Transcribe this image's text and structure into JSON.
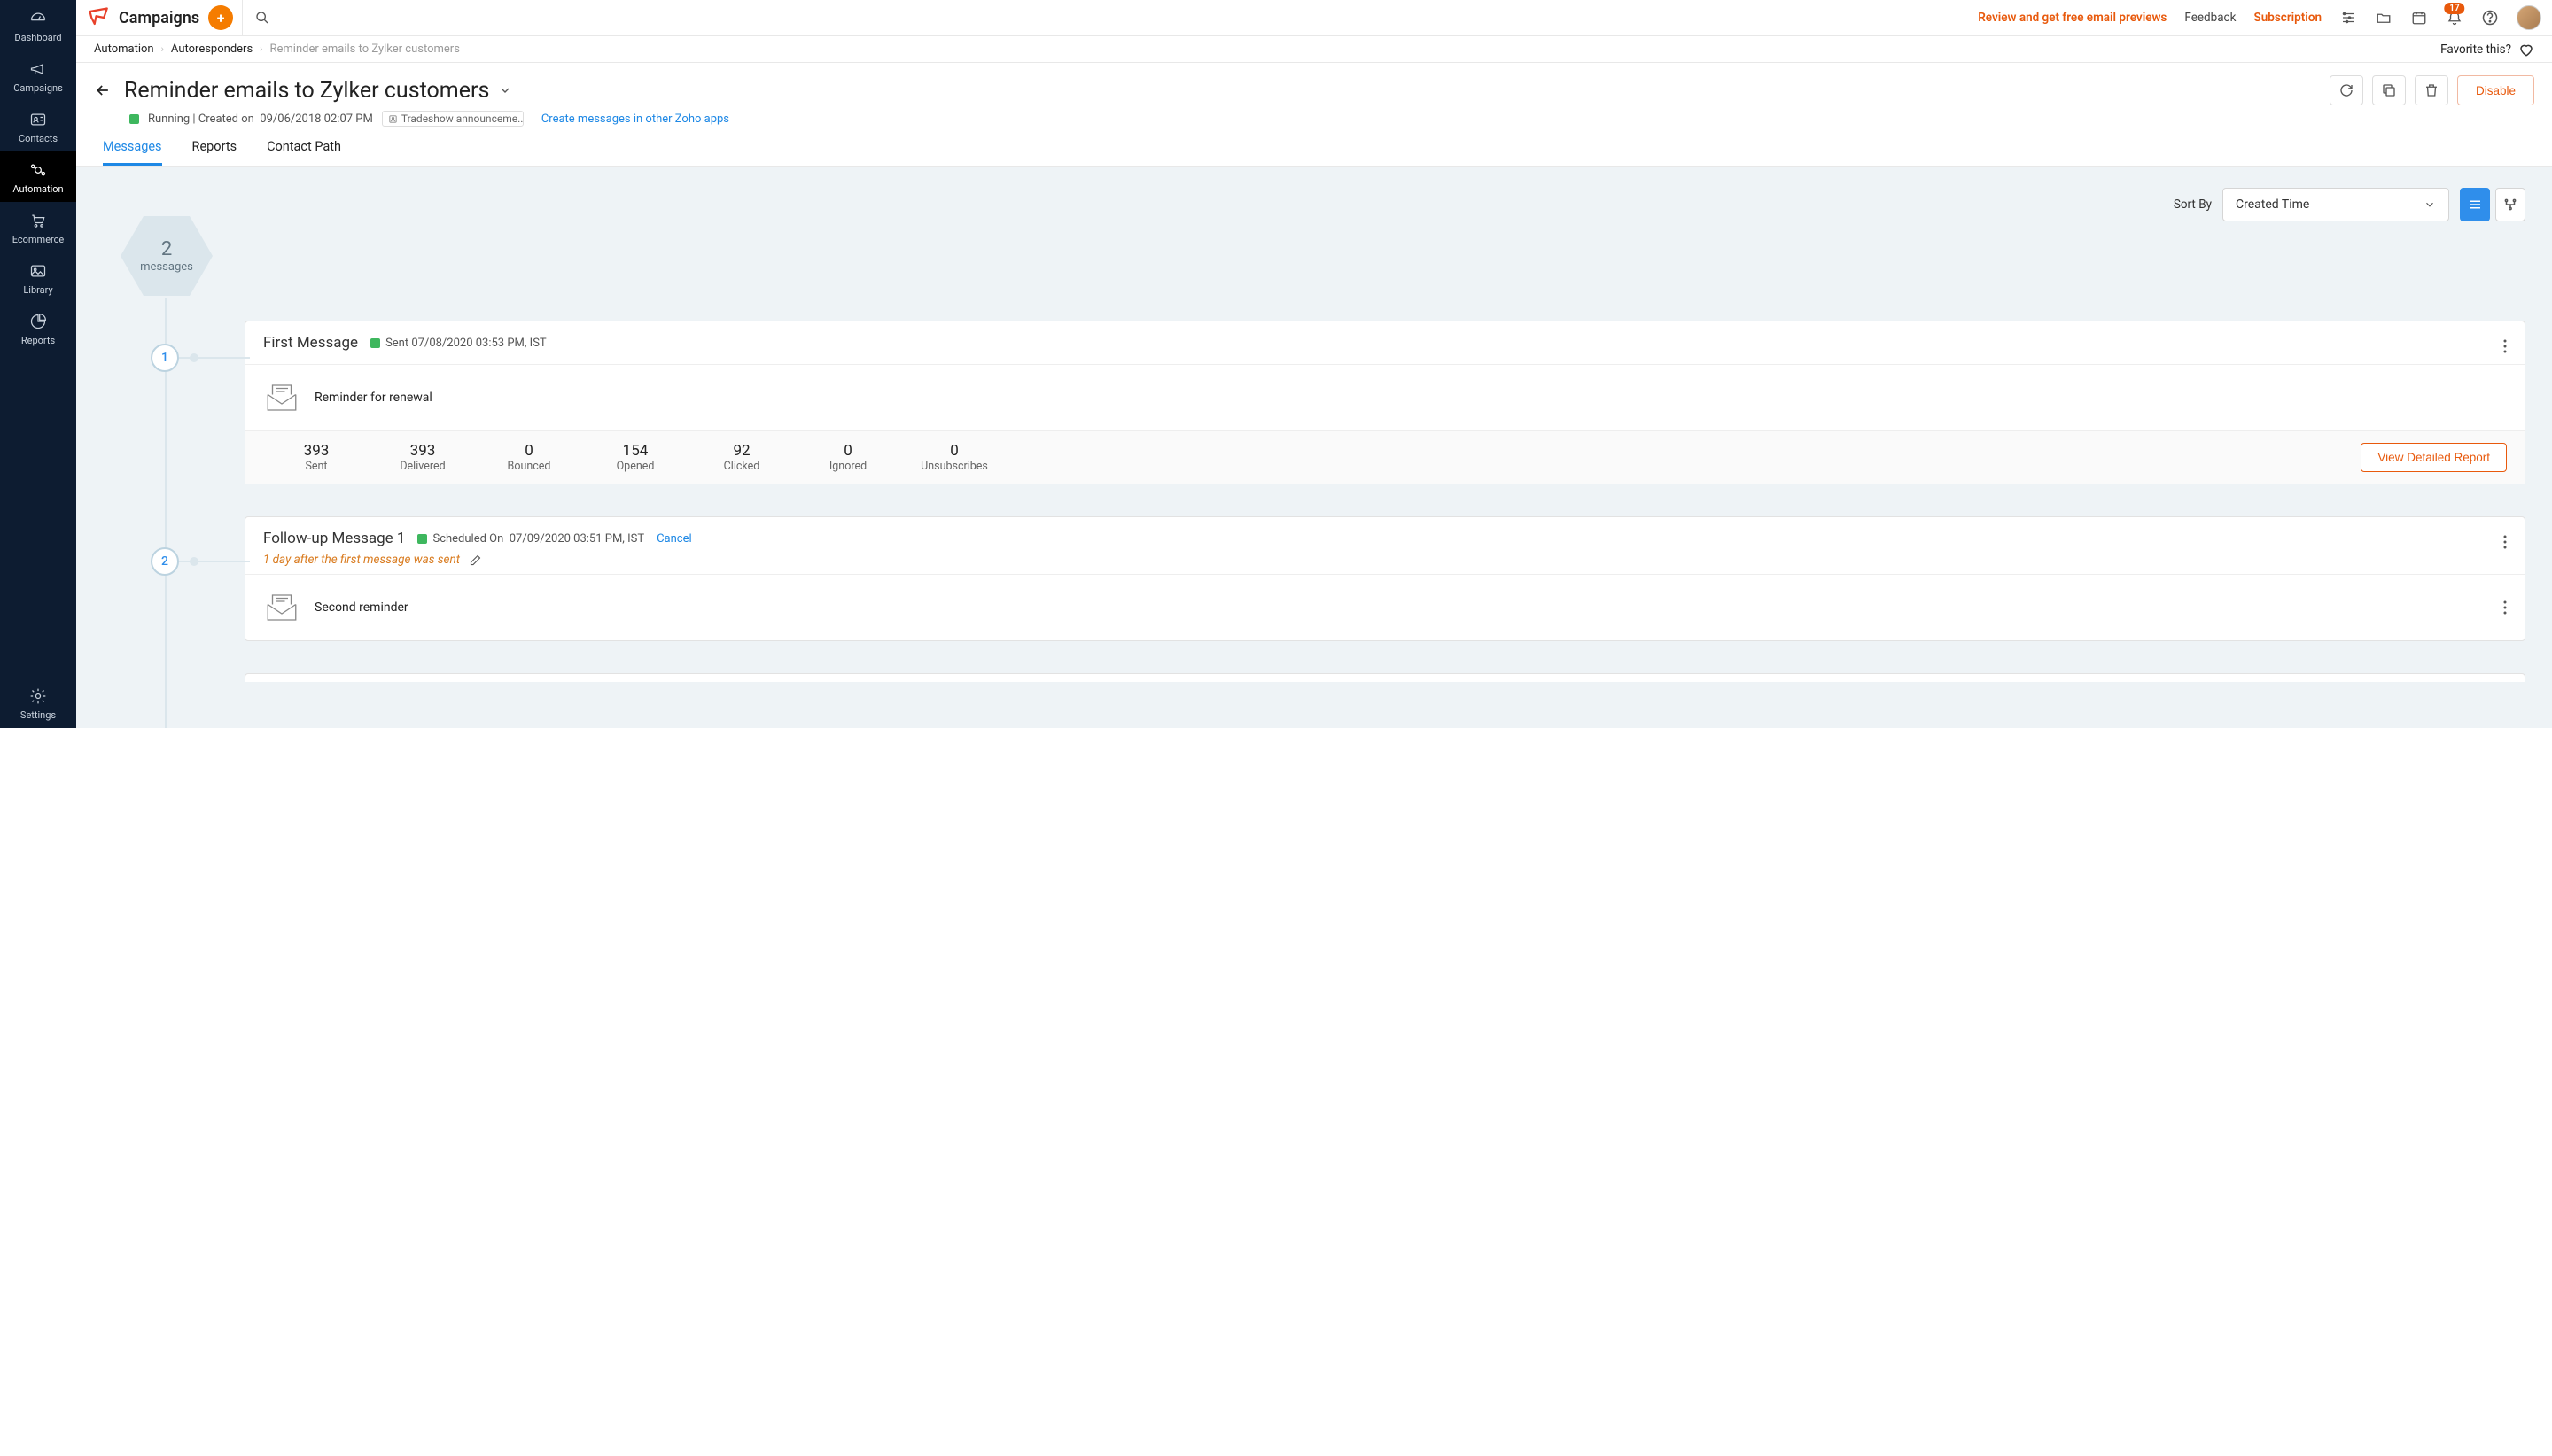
{
  "app": {
    "name": "Campaigns"
  },
  "topbar": {
    "review_link": "Review and get free email previews",
    "feedback": "Feedback",
    "subscription": "Subscription",
    "badge_count": "17"
  },
  "sidebar": {
    "dashboard": "Dashboard",
    "campaigns": "Campaigns",
    "contacts": "Contacts",
    "automation": "Automation",
    "ecommerce": "Ecommerce",
    "library": "Library",
    "reports": "Reports",
    "settings": "Settings"
  },
  "breadcrumb": {
    "automation": "Automation",
    "autoresponders": "Autoresponders",
    "current": "Reminder emails to Zylker customers",
    "favorite_label": "Favorite this?"
  },
  "header": {
    "title": "Reminder emails to Zylker customers",
    "status": "Running",
    "created_prefix": "Created on",
    "created_on": "09/06/2018 02:07 PM",
    "folder": "Tradeshow announceme...",
    "other_apps": "Create messages in other Zoho apps",
    "disable": "Disable"
  },
  "tabs": {
    "messages": "Messages",
    "reports": "Reports",
    "contact_path": "Contact Path"
  },
  "sort": {
    "label": "Sort By",
    "selected": "Created Time"
  },
  "summary": {
    "count": "2",
    "label": "messages"
  },
  "messages": [
    {
      "title": "First Message",
      "status_prefix": "Sent",
      "status_time": "07/08/2020 03:53 PM, IST",
      "subject": "Reminder for renewal",
      "stats": [
        {
          "n": "393",
          "l": "Sent"
        },
        {
          "n": "393",
          "l": "Delivered"
        },
        {
          "n": "0",
          "l": "Bounced"
        },
        {
          "n": "154",
          "l": "Opened"
        },
        {
          "n": "92",
          "l": "Clicked"
        },
        {
          "n": "0",
          "l": "Ignored"
        },
        {
          "n": "0",
          "l": "Unsubscribes"
        }
      ],
      "detail_btn": "View Detailed Report"
    },
    {
      "title": "Follow-up Message 1",
      "status_prefix": "Scheduled On",
      "status_time": "07/09/2020 03:51 PM, IST",
      "cancel": "Cancel",
      "delay": "1  day after the first message was sent",
      "subject": "Second reminder"
    }
  ]
}
